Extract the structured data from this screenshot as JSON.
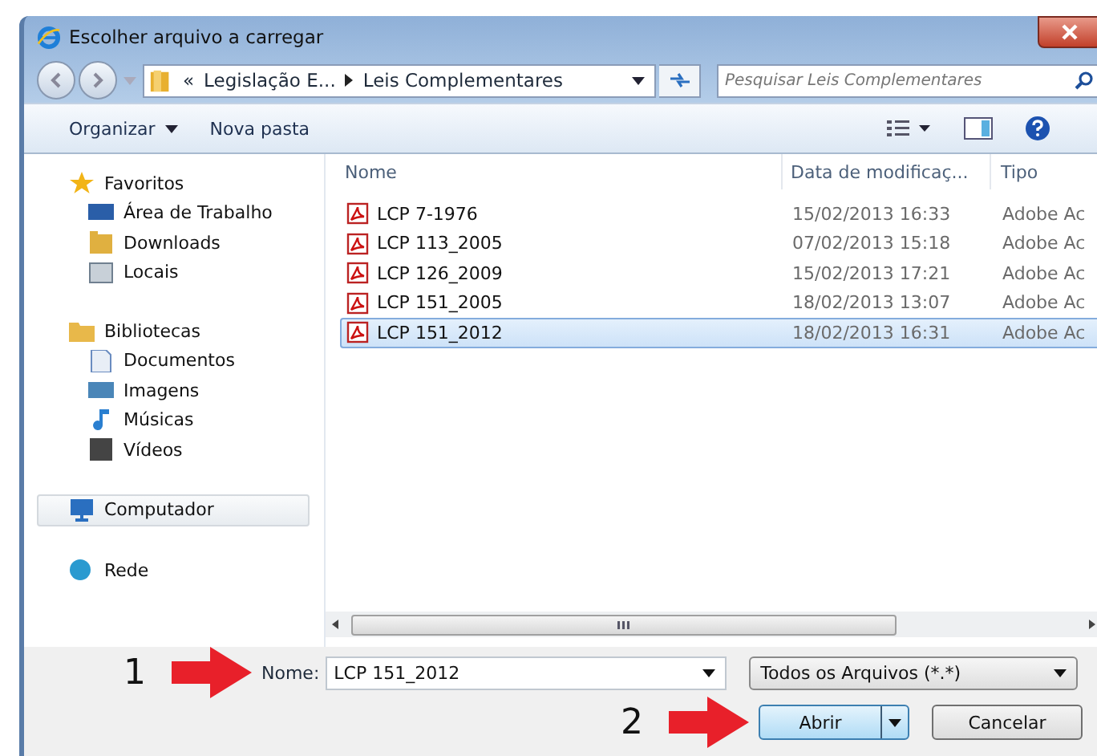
{
  "window": {
    "title": "Escolher arquivo a carregar"
  },
  "address": {
    "overflow": "«",
    "crumbs": [
      "Legislação E...",
      "Leis Complementares"
    ]
  },
  "search": {
    "placeholder": "Pesquisar Leis Complementares"
  },
  "toolbar": {
    "organize": "Organizar",
    "new_folder": "Nova pasta"
  },
  "sidebar": [
    {
      "label": "Favoritos",
      "selected": false,
      "children": [
        {
          "label": "Área de Trabalho",
          "selected": false
        },
        {
          "label": "Downloads",
          "selected": false
        },
        {
          "label": "Locais",
          "selected": false
        }
      ]
    },
    {
      "label": "Bibliotecas",
      "selected": false,
      "children": [
        {
          "label": "Documentos",
          "selected": false
        },
        {
          "label": "Imagens",
          "selected": false
        },
        {
          "label": "Músicas",
          "selected": false
        },
        {
          "label": "Vídeos",
          "selected": false
        }
      ]
    },
    {
      "label": "Computador",
      "selected": true
    },
    {
      "label": "Rede",
      "selected": false
    }
  ],
  "columns": [
    "Nome",
    "Data de modificaç...",
    "Tipo"
  ],
  "files": [
    {
      "name": "LCP 7-1976",
      "date": "15/02/2013 16:33",
      "type": "Adobe Ac",
      "selected": false
    },
    {
      "name": "LCP 113_2005",
      "date": "07/02/2013 15:18",
      "type": "Adobe Ac",
      "selected": false
    },
    {
      "name": "LCP 126_2009",
      "date": "15/02/2013 17:21",
      "type": "Adobe Ac",
      "selected": false
    },
    {
      "name": "LCP 151_2005",
      "date": "18/02/2013 13:07",
      "type": "Adobe Ac",
      "selected": false
    },
    {
      "name": "LCP 151_2012",
      "date": "18/02/2013 16:31",
      "type": "Adobe Ac",
      "selected": true
    }
  ],
  "filename": {
    "label": "Nome:",
    "value": "LCP 151_2012"
  },
  "filter": "Todos os Arquivos (*.*)",
  "buttons": {
    "open": "Abrir",
    "cancel": "Cancelar"
  },
  "annotations": [
    "1",
    "2"
  ]
}
